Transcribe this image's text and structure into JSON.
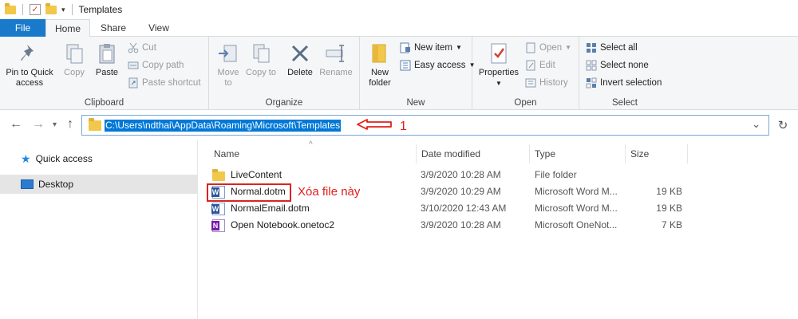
{
  "window": {
    "title": "Templates"
  },
  "tabs": [
    {
      "label": "File"
    },
    {
      "label": "Home"
    },
    {
      "label": "Share"
    },
    {
      "label": "View"
    }
  ],
  "ribbon": {
    "clipboard": {
      "label": "Clipboard",
      "pin": "Pin to Quick access",
      "copy": "Copy",
      "paste": "Paste",
      "cut": "Cut",
      "copy_path": "Copy path",
      "paste_shortcut": "Paste shortcut"
    },
    "organize": {
      "label": "Organize",
      "move_to": "Move to",
      "copy_to": "Copy to",
      "delete": "Delete",
      "rename": "Rename"
    },
    "new": {
      "label": "New",
      "new_folder": "New folder",
      "new_item": "New item",
      "easy_access": "Easy access"
    },
    "open": {
      "label": "Open",
      "properties": "Properties",
      "open": "Open",
      "edit": "Edit",
      "history": "History"
    },
    "select": {
      "label": "Select",
      "select_all": "Select all",
      "select_none": "Select none",
      "invert_selection": "Invert selection"
    }
  },
  "address": {
    "path": "C:\\Users\\ndthai\\AppData\\Roaming\\Microsoft\\Templates",
    "annotation_number": "1"
  },
  "nav": {
    "quick_access": "Quick access",
    "desktop": "Desktop"
  },
  "columns": {
    "name": "Name",
    "date": "Date modified",
    "type": "Type",
    "size": "Size"
  },
  "files": [
    {
      "name": "LiveContent",
      "date": "3/9/2020 10:28 AM",
      "type": "File folder",
      "size": "",
      "icon": "folder-icon"
    },
    {
      "name": "Normal.dotm",
      "date": "3/9/2020 10:29 AM",
      "type": "Microsoft Word M...",
      "size": "19 KB",
      "icon": "word-template-icon"
    },
    {
      "name": "NormalEmail.dotm",
      "date": "3/10/2020 12:43 AM",
      "type": "Microsoft Word M...",
      "size": "19 KB",
      "icon": "word-template-icon"
    },
    {
      "name": "Open Notebook.onetoc2",
      "date": "3/9/2020 10:28 AM",
      "type": "Microsoft OneNot...",
      "size": "7 KB",
      "icon": "onenote-icon"
    }
  ],
  "annotation": {
    "text": "Xóa file này"
  },
  "colors": {
    "accent": "#1979ca",
    "selection": "#0078d7",
    "annotation": "#e0201c"
  }
}
